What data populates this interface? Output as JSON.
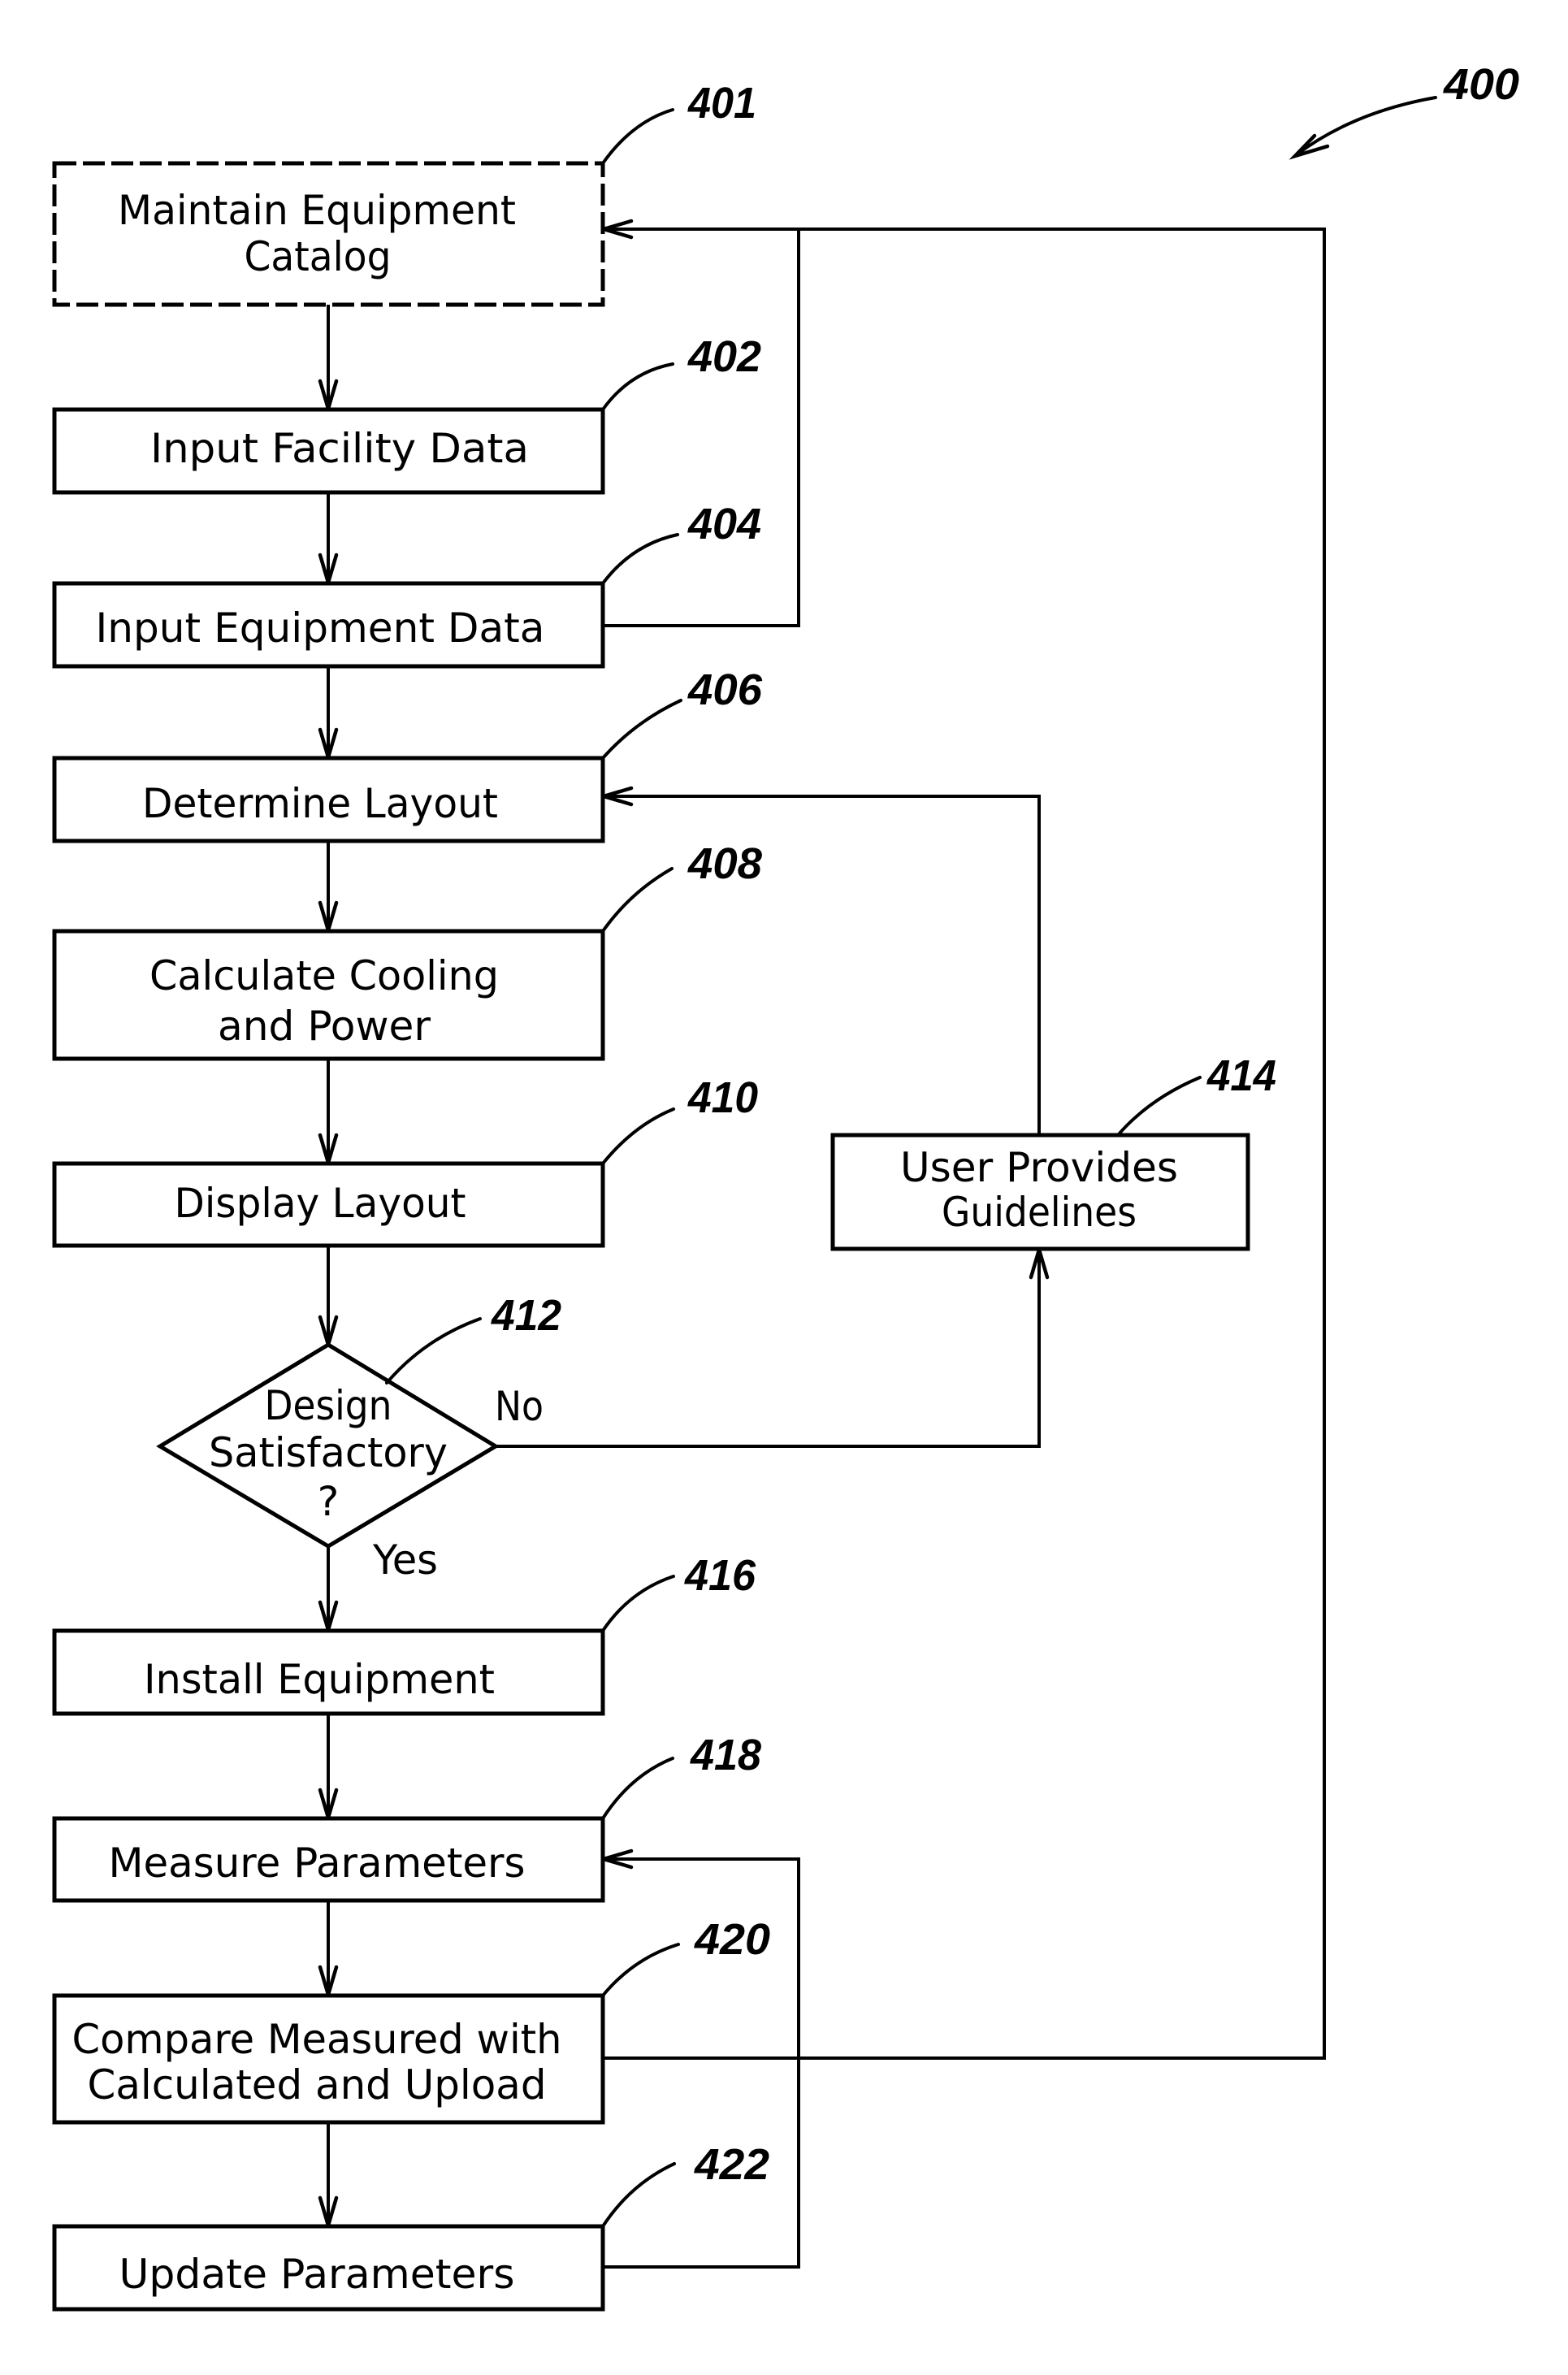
{
  "figure": {
    "reference": "400"
  },
  "nodes": [
    {
      "ref": "401",
      "shape": "dashed-box",
      "lines": [
        "Maintain Equipment",
        "Catalog"
      ]
    },
    {
      "ref": "402",
      "shape": "box",
      "lines": [
        "Input Facility Data"
      ]
    },
    {
      "ref": "404",
      "shape": "box",
      "lines": [
        "Input Equipment Data"
      ]
    },
    {
      "ref": "406",
      "shape": "box",
      "lines": [
        "Determine Layout"
      ]
    },
    {
      "ref": "408",
      "shape": "box",
      "lines": [
        "Calculate Cooling",
        "and Power"
      ]
    },
    {
      "ref": "410",
      "shape": "box",
      "lines": [
        "Display Layout"
      ]
    },
    {
      "ref": "412",
      "shape": "decision",
      "lines": [
        "Design",
        "Satisfactory",
        "?"
      ]
    },
    {
      "ref": "414",
      "shape": "box",
      "lines": [
        "User Provides",
        "Guidelines"
      ]
    },
    {
      "ref": "416",
      "shape": "box",
      "lines": [
        "Install Equipment"
      ]
    },
    {
      "ref": "418",
      "shape": "box",
      "lines": [
        "Measure Parameters"
      ]
    },
    {
      "ref": "420",
      "shape": "box",
      "lines": [
        "Compare Measured with",
        "Calculated and Upload"
      ]
    },
    {
      "ref": "422",
      "shape": "box",
      "lines": [
        "Update Parameters"
      ]
    }
  ],
  "edges": [
    {
      "from": "401",
      "to": "402"
    },
    {
      "from": "402",
      "to": "404"
    },
    {
      "from": "404",
      "to": "406"
    },
    {
      "from": "404",
      "to": "401"
    },
    {
      "from": "406",
      "to": "408"
    },
    {
      "from": "408",
      "to": "410"
    },
    {
      "from": "410",
      "to": "412"
    },
    {
      "from": "412",
      "to": "416",
      "label": "Yes"
    },
    {
      "from": "412",
      "to": "414",
      "label": "No"
    },
    {
      "from": "414",
      "to": "406"
    },
    {
      "from": "416",
      "to": "418"
    },
    {
      "from": "418",
      "to": "420"
    },
    {
      "from": "420",
      "to": "422"
    },
    {
      "from": "420",
      "to": "401"
    },
    {
      "from": "422",
      "to": "418"
    }
  ],
  "edge_labels": {
    "no": "No",
    "yes": "Yes"
  }
}
